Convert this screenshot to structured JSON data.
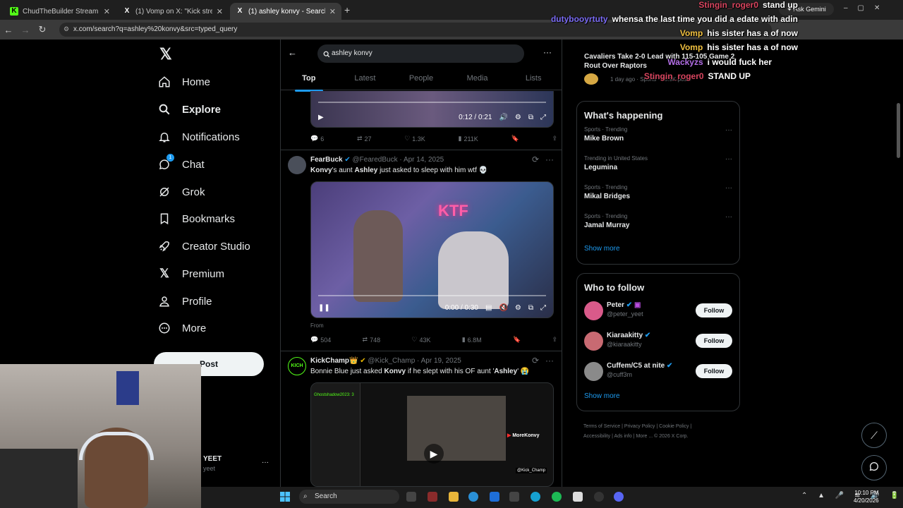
{
  "browser": {
    "tabs": [
      {
        "title": "ChudTheBuilder Stream - Watc",
        "favicon": "K"
      },
      {
        "title": "(1) Vomp on X: \"Kick streamer E",
        "favicon": "X"
      },
      {
        "title": "(1) ashley konvy - Search / X",
        "favicon": "X"
      }
    ],
    "new_tab": "+",
    "url": "x.com/search?q=ashley%20konvy&src=typed_query",
    "ask_gemini": "Ask Gemini"
  },
  "sidebar": {
    "items": [
      {
        "label": "Home",
        "icon": "home-icon"
      },
      {
        "label": "Explore",
        "icon": "search-icon"
      },
      {
        "label": "Notifications",
        "icon": "bell-icon"
      },
      {
        "label": "Chat",
        "icon": "chat-icon",
        "badge": "1"
      },
      {
        "label": "Grok",
        "icon": "grok-icon"
      },
      {
        "label": "Bookmarks",
        "icon": "bookmark-icon"
      },
      {
        "label": "Creator Studio",
        "icon": "rocket-icon"
      },
      {
        "label": "Premium",
        "icon": "x-logo-icon"
      },
      {
        "label": "Profile",
        "icon": "person-icon"
      },
      {
        "label": "More",
        "icon": "more-circle-icon"
      }
    ],
    "post_label": "Post",
    "account_name": "YEET",
    "account_handle": "yeet"
  },
  "search": {
    "query": "ashley konvy",
    "tabs": [
      "Top",
      "Latest",
      "People",
      "Media",
      "Lists"
    ],
    "active_tab": "Top"
  },
  "tweets": [
    {
      "video_time": "0:12 / 0:21",
      "replies": "6",
      "reposts": "27",
      "likes": "1.3K",
      "views": "211K"
    },
    {
      "name": "FearBuck",
      "handle": "@FearedBuck",
      "date": "· Apr 14, 2025",
      "text_prefix": "Konvy",
      "text_mid1": "'s aunt ",
      "text_bold2": "Ashley",
      "text_suffix": " just asked to sleep with him wtf 💀",
      "video_time": "0:00 / 0:30",
      "video_overlay": "KTF",
      "from_label": "From",
      "replies": "504",
      "reposts": "748",
      "likes": "43K",
      "views": "6.8M"
    },
    {
      "name": "KickChamp👑",
      "handle": "@Kick_Champ",
      "date": "· Apr 19, 2025",
      "text_a": "Bonnie Blue just asked ",
      "text_b": "Konvy",
      "text_c": " if he slept with his OF aunt '",
      "text_d": "Ashley",
      "text_e": "' 😭",
      "media_watermark": "MoreKonvy",
      "media_handle": "@Kick_Champ",
      "media_chat_user": "Ghostshadow2023: 3",
      "avatar_label": "KICH"
    }
  ],
  "right": {
    "top_news": {
      "title": "Cavaliers Take 2-0 Lead with 115-105 Game 2 Rout Over Raptors",
      "meta": "1 day ago · Sports · 18.9K posts"
    },
    "happening_title": "What's happening",
    "trends": [
      {
        "meta": "Sports · Trending",
        "topic": "Mike Brown"
      },
      {
        "meta": "Trending in United States",
        "topic": "Legumina"
      },
      {
        "meta": "Sports · Trending",
        "topic": "Mikal Bridges"
      },
      {
        "meta": "Sports · Trending",
        "topic": "Jamal Murray"
      }
    ],
    "show_more": "Show more",
    "who_to_follow_title": "Who to follow",
    "follow": [
      {
        "name": "Peter",
        "handle": "@peter_yeet",
        "avatar_color": "#d95a8a"
      },
      {
        "name": "Kiaraakitty",
        "handle": "@kiaraakitty",
        "avatar_color": "#c86a72"
      },
      {
        "name": "Cuffem/C5 at nite",
        "handle": "@cuff3m",
        "avatar_color": "#8a8a8a"
      }
    ],
    "follow_label": "Follow",
    "footer": [
      "Terms of Service",
      "Privacy Policy",
      "Cookie Policy",
      "Accessibility",
      "Ads info",
      "More ...",
      "© 2026 X Corp."
    ]
  },
  "chat_overlay": [
    {
      "user": "Stingin_roger0",
      "msg": "stand up",
      "color": "#d9455f"
    },
    {
      "user": "dutybooyrtuty",
      "msg": "whensa the last time you did a edate with adin",
      "color": "#7b6cf5"
    },
    {
      "user": "Vomp",
      "msg": "his sister has a of now",
      "color": "#f0c040"
    },
    {
      "user": "Vomp",
      "msg": "his sister has a of now",
      "color": "#f0c040"
    },
    {
      "user": "Wackyzs",
      "msg": "i would fuck her",
      "color": "#b36ee6"
    },
    {
      "user": "Stingin_roger0",
      "msg": "STAND UP",
      "color": "#d9455f"
    }
  ],
  "taskbar": {
    "search_placeholder": "Search",
    "time": "10:10 PM",
    "date": "4/20/2026"
  },
  "colors": {
    "accent": "#1d9bf0",
    "background": "#000000",
    "border": "#2f3336"
  }
}
